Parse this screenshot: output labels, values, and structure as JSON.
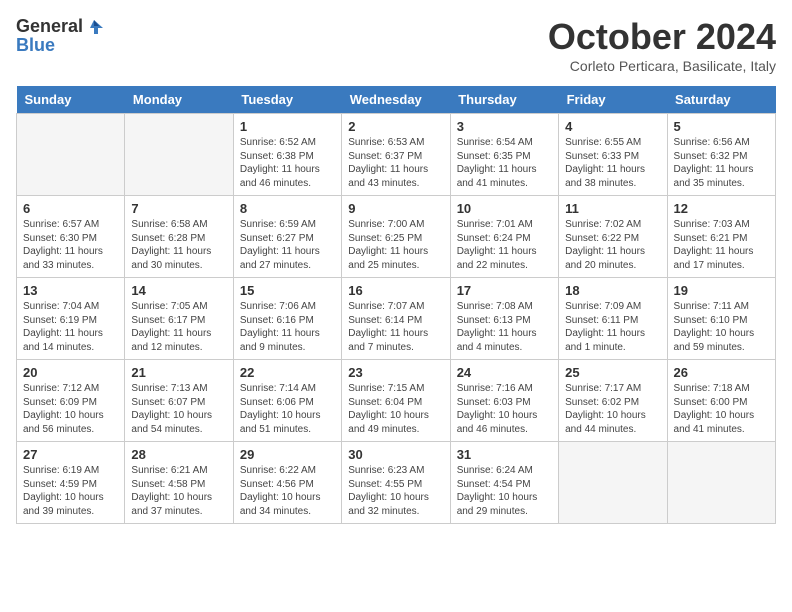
{
  "logo": {
    "general": "General",
    "blue": "Blue"
  },
  "title": "October 2024",
  "location": "Corleto Perticara, Basilicate, Italy",
  "days": [
    "Sunday",
    "Monday",
    "Tuesday",
    "Wednesday",
    "Thursday",
    "Friday",
    "Saturday"
  ],
  "weeks": [
    [
      {
        "day": "",
        "empty": true
      },
      {
        "day": "",
        "empty": true
      },
      {
        "day": "1",
        "sunrise": "Sunrise: 6:52 AM",
        "sunset": "Sunset: 6:38 PM",
        "daylight": "Daylight: 11 hours and 46 minutes."
      },
      {
        "day": "2",
        "sunrise": "Sunrise: 6:53 AM",
        "sunset": "Sunset: 6:37 PM",
        "daylight": "Daylight: 11 hours and 43 minutes."
      },
      {
        "day": "3",
        "sunrise": "Sunrise: 6:54 AM",
        "sunset": "Sunset: 6:35 PM",
        "daylight": "Daylight: 11 hours and 41 minutes."
      },
      {
        "day": "4",
        "sunrise": "Sunrise: 6:55 AM",
        "sunset": "Sunset: 6:33 PM",
        "daylight": "Daylight: 11 hours and 38 minutes."
      },
      {
        "day": "5",
        "sunrise": "Sunrise: 6:56 AM",
        "sunset": "Sunset: 6:32 PM",
        "daylight": "Daylight: 11 hours and 35 minutes."
      }
    ],
    [
      {
        "day": "6",
        "sunrise": "Sunrise: 6:57 AM",
        "sunset": "Sunset: 6:30 PM",
        "daylight": "Daylight: 11 hours and 33 minutes."
      },
      {
        "day": "7",
        "sunrise": "Sunrise: 6:58 AM",
        "sunset": "Sunset: 6:28 PM",
        "daylight": "Daylight: 11 hours and 30 minutes."
      },
      {
        "day": "8",
        "sunrise": "Sunrise: 6:59 AM",
        "sunset": "Sunset: 6:27 PM",
        "daylight": "Daylight: 11 hours and 27 minutes."
      },
      {
        "day": "9",
        "sunrise": "Sunrise: 7:00 AM",
        "sunset": "Sunset: 6:25 PM",
        "daylight": "Daylight: 11 hours and 25 minutes."
      },
      {
        "day": "10",
        "sunrise": "Sunrise: 7:01 AM",
        "sunset": "Sunset: 6:24 PM",
        "daylight": "Daylight: 11 hours and 22 minutes."
      },
      {
        "day": "11",
        "sunrise": "Sunrise: 7:02 AM",
        "sunset": "Sunset: 6:22 PM",
        "daylight": "Daylight: 11 hours and 20 minutes."
      },
      {
        "day": "12",
        "sunrise": "Sunrise: 7:03 AM",
        "sunset": "Sunset: 6:21 PM",
        "daylight": "Daylight: 11 hours and 17 minutes."
      }
    ],
    [
      {
        "day": "13",
        "sunrise": "Sunrise: 7:04 AM",
        "sunset": "Sunset: 6:19 PM",
        "daylight": "Daylight: 11 hours and 14 minutes."
      },
      {
        "day": "14",
        "sunrise": "Sunrise: 7:05 AM",
        "sunset": "Sunset: 6:17 PM",
        "daylight": "Daylight: 11 hours and 12 minutes."
      },
      {
        "day": "15",
        "sunrise": "Sunrise: 7:06 AM",
        "sunset": "Sunset: 6:16 PM",
        "daylight": "Daylight: 11 hours and 9 minutes."
      },
      {
        "day": "16",
        "sunrise": "Sunrise: 7:07 AM",
        "sunset": "Sunset: 6:14 PM",
        "daylight": "Daylight: 11 hours and 7 minutes."
      },
      {
        "day": "17",
        "sunrise": "Sunrise: 7:08 AM",
        "sunset": "Sunset: 6:13 PM",
        "daylight": "Daylight: 11 hours and 4 minutes."
      },
      {
        "day": "18",
        "sunrise": "Sunrise: 7:09 AM",
        "sunset": "Sunset: 6:11 PM",
        "daylight": "Daylight: 11 hours and 1 minute."
      },
      {
        "day": "19",
        "sunrise": "Sunrise: 7:11 AM",
        "sunset": "Sunset: 6:10 PM",
        "daylight": "Daylight: 10 hours and 59 minutes."
      }
    ],
    [
      {
        "day": "20",
        "sunrise": "Sunrise: 7:12 AM",
        "sunset": "Sunset: 6:09 PM",
        "daylight": "Daylight: 10 hours and 56 minutes."
      },
      {
        "day": "21",
        "sunrise": "Sunrise: 7:13 AM",
        "sunset": "Sunset: 6:07 PM",
        "daylight": "Daylight: 10 hours and 54 minutes."
      },
      {
        "day": "22",
        "sunrise": "Sunrise: 7:14 AM",
        "sunset": "Sunset: 6:06 PM",
        "daylight": "Daylight: 10 hours and 51 minutes."
      },
      {
        "day": "23",
        "sunrise": "Sunrise: 7:15 AM",
        "sunset": "Sunset: 6:04 PM",
        "daylight": "Daylight: 10 hours and 49 minutes."
      },
      {
        "day": "24",
        "sunrise": "Sunrise: 7:16 AM",
        "sunset": "Sunset: 6:03 PM",
        "daylight": "Daylight: 10 hours and 46 minutes."
      },
      {
        "day": "25",
        "sunrise": "Sunrise: 7:17 AM",
        "sunset": "Sunset: 6:02 PM",
        "daylight": "Daylight: 10 hours and 44 minutes."
      },
      {
        "day": "26",
        "sunrise": "Sunrise: 7:18 AM",
        "sunset": "Sunset: 6:00 PM",
        "daylight": "Daylight: 10 hours and 41 minutes."
      }
    ],
    [
      {
        "day": "27",
        "sunrise": "Sunrise: 6:19 AM",
        "sunset": "Sunset: 4:59 PM",
        "daylight": "Daylight: 10 hours and 39 minutes."
      },
      {
        "day": "28",
        "sunrise": "Sunrise: 6:21 AM",
        "sunset": "Sunset: 4:58 PM",
        "daylight": "Daylight: 10 hours and 37 minutes."
      },
      {
        "day": "29",
        "sunrise": "Sunrise: 6:22 AM",
        "sunset": "Sunset: 4:56 PM",
        "daylight": "Daylight: 10 hours and 34 minutes."
      },
      {
        "day": "30",
        "sunrise": "Sunrise: 6:23 AM",
        "sunset": "Sunset: 4:55 PM",
        "daylight": "Daylight: 10 hours and 32 minutes."
      },
      {
        "day": "31",
        "sunrise": "Sunrise: 6:24 AM",
        "sunset": "Sunset: 4:54 PM",
        "daylight": "Daylight: 10 hours and 29 minutes."
      },
      {
        "day": "",
        "empty": true
      },
      {
        "day": "",
        "empty": true
      }
    ]
  ]
}
